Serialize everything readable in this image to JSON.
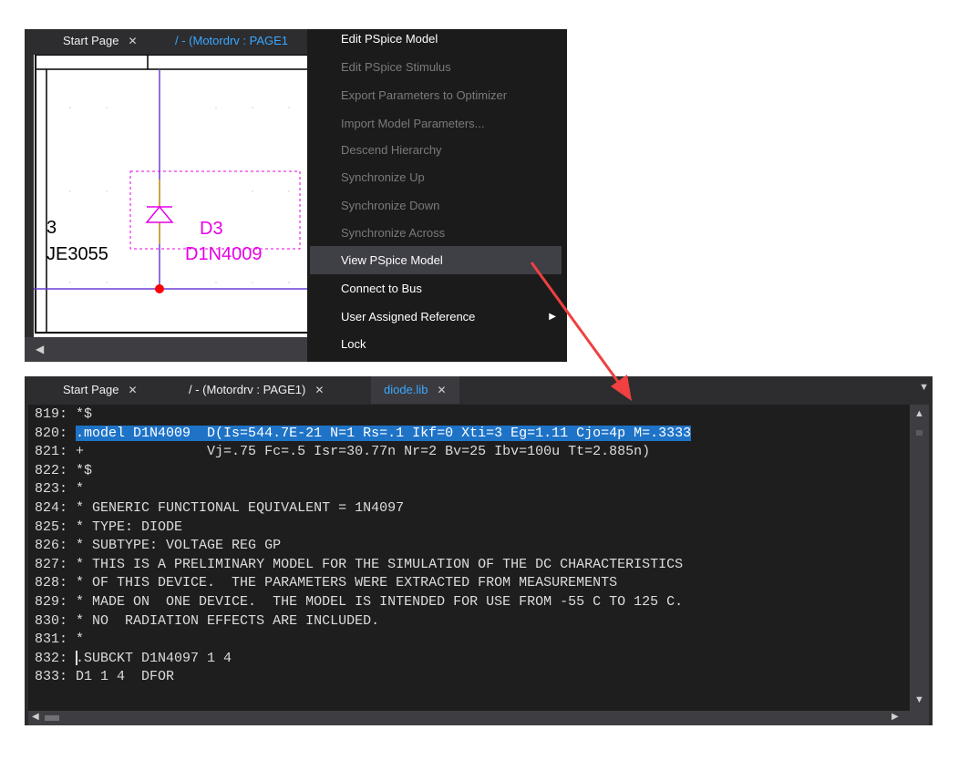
{
  "top_window": {
    "tabs": [
      {
        "label": "Start Page",
        "close": "✕"
      },
      {
        "label": "/ - (Motordrv : PAGE1"
      }
    ],
    "schematic": {
      "part_ref": "D3",
      "part_value": "D1N4009",
      "left_ref": "3",
      "left_value": "JE3055"
    },
    "scroll_left": "◀"
  },
  "context_menu": {
    "items": [
      {
        "label": "Edit PSpice Model",
        "state": "enabled"
      },
      {
        "label": "Edit PSpice Stimulus",
        "state": "disabled"
      },
      {
        "label": "Export Parameters to Optimizer",
        "state": "disabled"
      },
      {
        "label": "Import Model Parameters...",
        "state": "disabled"
      },
      {
        "label": "Descend Hierarchy",
        "state": "disabled"
      },
      {
        "label": "Synchronize Up",
        "state": "disabled"
      },
      {
        "label": "Synchronize Down",
        "state": "disabled"
      },
      {
        "label": "Synchronize Across",
        "state": "disabled"
      },
      {
        "label": "View PSpice Model",
        "state": "highlighted"
      },
      {
        "label": "Connect to Bus",
        "state": "enabled"
      },
      {
        "label": "User Assigned Reference",
        "state": "enabled",
        "submenu": "▶"
      },
      {
        "label": "Lock",
        "state": "enabled"
      }
    ]
  },
  "editor": {
    "tabs": [
      {
        "label": "Start Page",
        "close": "✕"
      },
      {
        "label": "/ - (Motordrv : PAGE1)",
        "close": "✕"
      },
      {
        "label": "diode.lib",
        "close": "✕"
      }
    ],
    "dropdown": "▼",
    "lines": [
      {
        "num": "819:",
        "text": "*$"
      },
      {
        "num": "820:",
        "text": ".model D1N4009  D(Is=544.7E-21 N=1 Rs=.1 Ikf=0 Xti=3 Eg=1.11 Cjo=4p M=.3333",
        "selected": true
      },
      {
        "num": "821:",
        "text": "+               Vj=.75 Fc=.5 Isr=30.77n Nr=2 Bv=25 Ibv=100u Tt=2.885n)"
      },
      {
        "num": "822:",
        "text": "*$"
      },
      {
        "num": "823:",
        "text": "*"
      },
      {
        "num": "824:",
        "text": "* GENERIC FUNCTIONAL EQUIVALENT = 1N4097"
      },
      {
        "num": "825:",
        "text": "* TYPE: DIODE"
      },
      {
        "num": "826:",
        "text": "* SUBTYPE: VOLTAGE REG GP"
      },
      {
        "num": "827:",
        "text": "* THIS IS A PRELIMINARY MODEL FOR THE SIMULATION OF THE DC CHARACTERISTICS"
      },
      {
        "num": "828:",
        "text": "* OF THIS DEVICE.  THE PARAMETERS WERE EXTRACTED FROM MEASUREMENTS"
      },
      {
        "num": "829:",
        "text": "* MADE ON  ONE DEVICE.  THE MODEL IS INTENDED FOR USE FROM -55 C TO 125 C."
      },
      {
        "num": "830:",
        "text": "* NO  RADIATION EFFECTS ARE INCLUDED."
      },
      {
        "num": "831:",
        "text": "*"
      },
      {
        "num": "832:",
        "text": ".SUBCKT D1N4097 1 4",
        "caret": true
      },
      {
        "num": "833:",
        "text": "D1 1 4  DFOR"
      }
    ],
    "scroll": {
      "up": "▲",
      "down": "▼",
      "left": "◀",
      "right": "▶"
    }
  },
  "colors": {
    "accent_tab": "#3aa7ff",
    "selection": "#1e73c7",
    "part": "#e600e6",
    "wire": "#6a3fd6",
    "junction": "#ff0000",
    "arrow": "#f04040"
  }
}
